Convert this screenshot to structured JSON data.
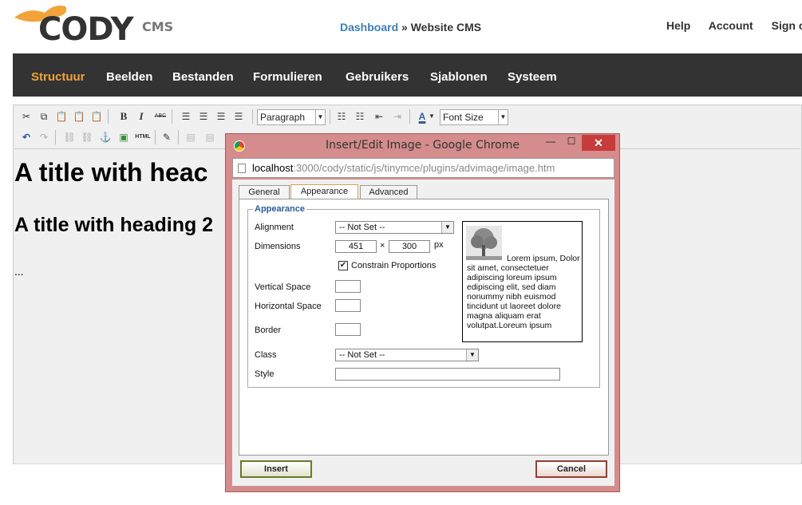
{
  "header": {
    "logo_text": "CODY",
    "logo_suffix": "CMS",
    "breadcrumb_link": "Dashboard",
    "breadcrumb_sep": " » ",
    "breadcrumb_current": "Website CMS",
    "links": [
      "Help",
      "Account",
      "Sign ou"
    ]
  },
  "nav": {
    "items": [
      "Structuur",
      "Beelden",
      "Bestanden",
      "Formulieren",
      "Gebruikers",
      "Sjablonen",
      "Systeem"
    ],
    "active_color": "#f2a33a",
    "bg_color": "#333333"
  },
  "toolbar": {
    "format_select": "Paragraph",
    "fontsize_select": "Font Size",
    "icons_row1": [
      "cut-icon",
      "copy-icon",
      "paste-icon",
      "paste-text-icon",
      "paste-word-icon",
      "bold-icon",
      "italic-icon",
      "strikethrough-icon",
      "align-left-icon",
      "align-center-icon",
      "align-right-icon",
      "justify-icon",
      "bullet-list-icon",
      "numbered-list-icon",
      "outdent-icon",
      "indent-icon",
      "text-color-icon"
    ],
    "icons_row2": [
      "undo-icon",
      "redo-icon",
      "link-icon",
      "unlink-icon",
      "anchor-icon",
      "image-icon",
      "html-icon",
      "edit-icon"
    ],
    "bold": "B",
    "italic": "I",
    "strike": "ABC",
    "html": "HTML",
    "text_color": "A"
  },
  "content": {
    "h1": "A title with heac",
    "h2": "A title with heading 2",
    "paragraph": "..."
  },
  "dialog": {
    "title": "Insert/Edit Image - Google Chrome",
    "url_host": "localhost",
    "url_path": ":3000/cody/static/js/tinymce/plugins/advimage/image.htm",
    "tabs": [
      "General",
      "Appearance",
      "Advanced"
    ],
    "active_tab": "Appearance",
    "legend": "Appearance",
    "labels": {
      "alignment": "Alignment",
      "dimensions": "Dimensions",
      "constrain": "Constrain Proportions",
      "vspace": "Vertical Space",
      "hspace": "Horizontal Space",
      "border": "Border",
      "class": "Class",
      "style": "Style"
    },
    "alignment_value": "-- Not Set --",
    "width_value": "451",
    "times": "×",
    "height_value": "300",
    "unit": "px",
    "constrain_checked": true,
    "class_value": "-- Not Set --",
    "preview_text": "Lorem ipsum, Dolor sit amet, consectetuer adipiscing loreum ipsum edipiscing elit, sed diam nonummy nibh euismod tincidunt ut laoreet dolore magna aliquam erat volutpat.Loreum ipsum",
    "insert_label": "Insert",
    "cancel_label": "Cancel",
    "close_label": "✕",
    "minimize_label": "—",
    "maximize_label": "☐"
  }
}
